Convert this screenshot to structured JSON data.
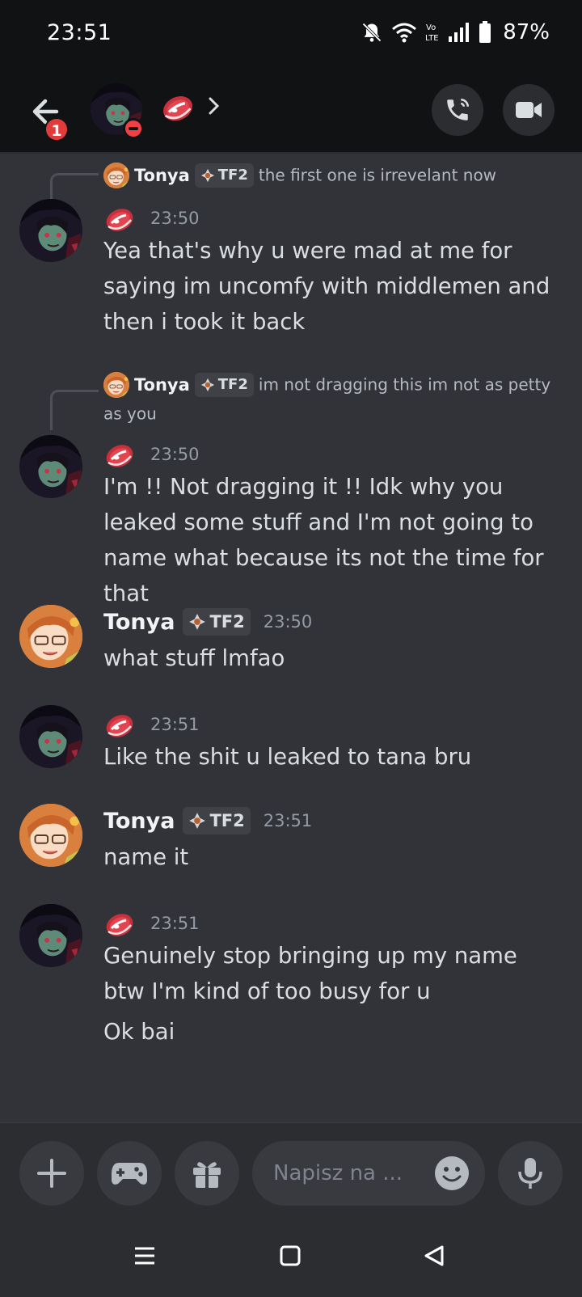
{
  "status_bar": {
    "time": "23:51",
    "battery": "87%",
    "icons": [
      "mute-bell-icon",
      "wifi-icon",
      "volte-icon",
      "signal-icon",
      "battery-icon"
    ]
  },
  "header": {
    "unread_count": "1",
    "user_status": "do-not-disturb",
    "name_emoji": "meat-emoji"
  },
  "messages": [
    {
      "reply": {
        "author": "Tonya",
        "tag": "TF2",
        "text": "the first one is irrevelant now"
      },
      "author_emoji": "meat-emoji",
      "time": "23:50",
      "lines": [
        "Yea that's why u were mad at me for saying im uncomfy with middlemen and then i took it back"
      ]
    },
    {
      "reply": {
        "author": "Tonya",
        "tag": "TF2",
        "text": "im not dragging this im not as petty as you"
      },
      "author_emoji": "meat-emoji",
      "time": "23:50",
      "lines": [
        "I'm !! Not dragging it !! Idk why you leaked some stuff and I'm not going to name what because its not the time for that"
      ]
    },
    {
      "author": "Tonya",
      "tag": "TF2",
      "time": "23:50",
      "lines": [
        "what stuff lmfao"
      ]
    },
    {
      "author_emoji": "meat-emoji",
      "time": "23:51",
      "lines": [
        "Like the shit u leaked to tana bru"
      ]
    },
    {
      "author": "Tonya",
      "tag": "TF2",
      "time": "23:51",
      "lines": [
        "name it"
      ]
    },
    {
      "author_emoji": "meat-emoji",
      "time": "23:51",
      "lines": [
        "Genuinely stop bringing up my name btw I'm kind of too busy for u",
        "Ok bai"
      ]
    }
  ],
  "composer": {
    "placeholder": "Napisz na ...",
    "buttons": [
      "plus-icon",
      "gamepad-icon",
      "gift-icon",
      "emoji-icon",
      "microphone-icon"
    ]
  },
  "colors": {
    "background": "#323339",
    "header": "#111214",
    "composer": "#2b2d31",
    "text": "#dbdee1",
    "muted": "#949ba4",
    "badge": "#e23b3b",
    "dnd": "#f23f43"
  }
}
